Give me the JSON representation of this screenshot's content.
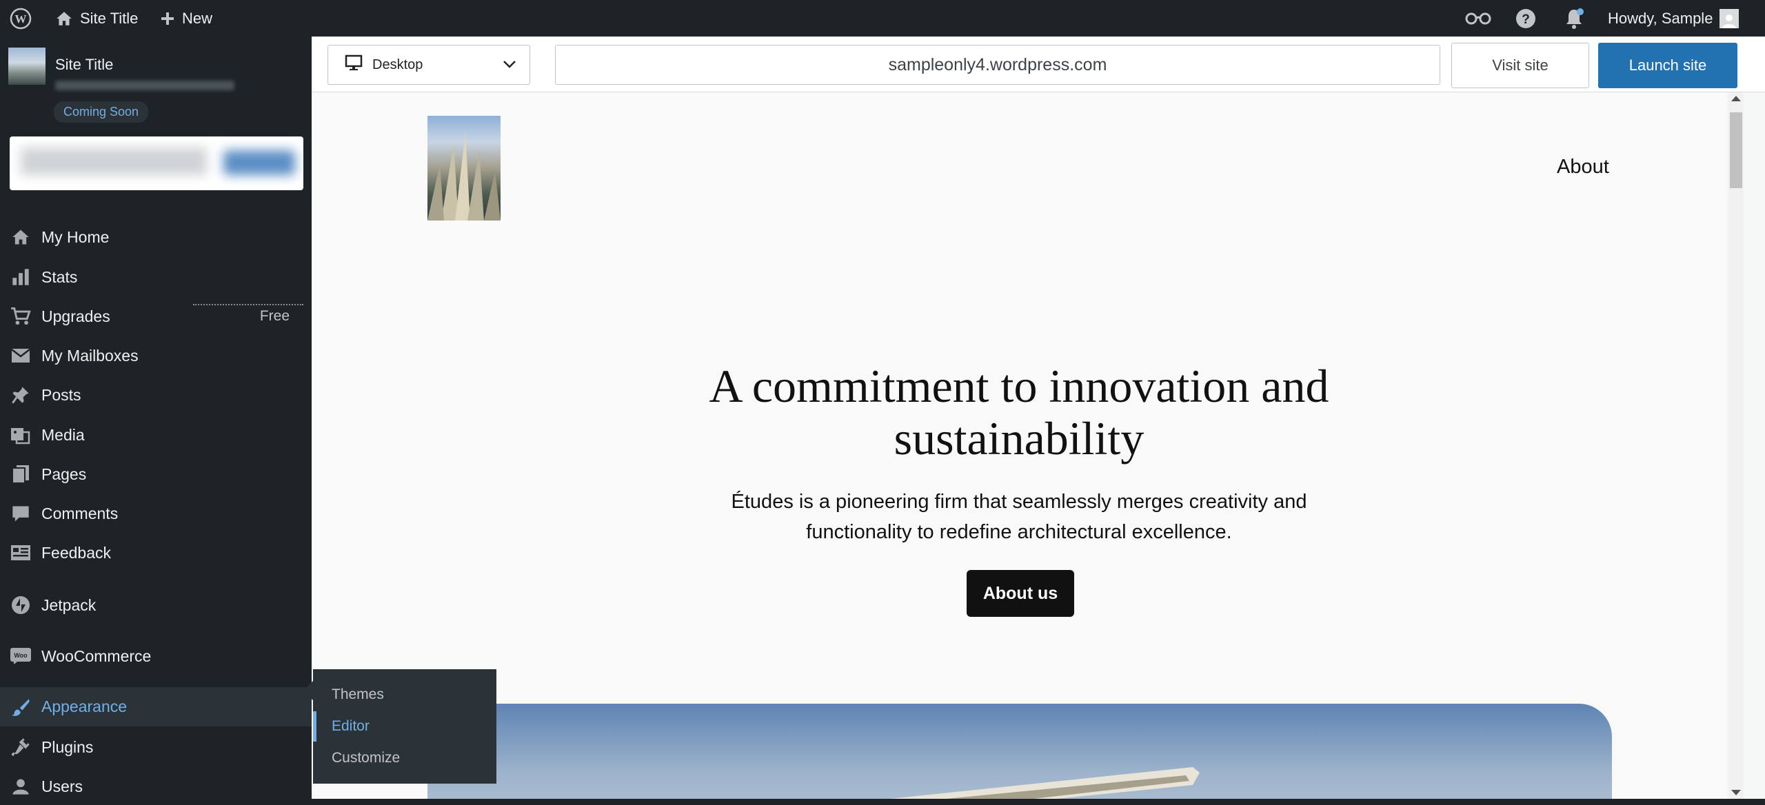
{
  "admin_bar": {
    "site_title": "Site Title",
    "new_label": "New",
    "howdy": "Howdy, Sample"
  },
  "sidebar": {
    "site_title": "Site Title",
    "status_badge": "Coming Soon",
    "items": [
      {
        "label": "My Home",
        "icon": "home-icon"
      },
      {
        "label": "Stats",
        "icon": "stats-icon"
      },
      {
        "label": "Upgrades",
        "icon": "cart-icon",
        "badge": "Free"
      },
      {
        "label": "My Mailboxes",
        "icon": "mail-icon"
      },
      {
        "label": "Posts",
        "icon": "pin-icon"
      },
      {
        "label": "Media",
        "icon": "media-icon"
      },
      {
        "label": "Pages",
        "icon": "pages-icon"
      },
      {
        "label": "Comments",
        "icon": "comment-icon"
      },
      {
        "label": "Feedback",
        "icon": "feedback-icon"
      },
      {
        "label": "Jetpack",
        "icon": "jetpack-icon"
      },
      {
        "label": "WooCommerce",
        "icon": "woo-icon"
      },
      {
        "label": "Appearance",
        "icon": "brush-icon",
        "active": true
      },
      {
        "label": "Plugins",
        "icon": "plugin-icon"
      },
      {
        "label": "Users",
        "icon": "user-icon"
      }
    ],
    "appearance_submenu": [
      {
        "label": "Themes"
      },
      {
        "label": "Editor",
        "current": true
      },
      {
        "label": "Customize"
      }
    ]
  },
  "toolbar": {
    "device": "Desktop",
    "url": "sampleonly4.wordpress.com",
    "visit_label": "Visit site",
    "launch_label": "Launch site"
  },
  "preview": {
    "nav_about": "About",
    "hero_title_line1": "A commitment to innovation and",
    "hero_title_line2": "sustainability",
    "hero_sub_line1": "Études is a pioneering firm that seamlessly merges creativity and",
    "hero_sub_line2": "functionality to redefine architectural excellence.",
    "hero_button": "About us"
  },
  "colors": {
    "admin_bg": "#1d2327",
    "accent": "#72aee6",
    "primary_button": "#2271b1",
    "hero_button": "#111111"
  }
}
